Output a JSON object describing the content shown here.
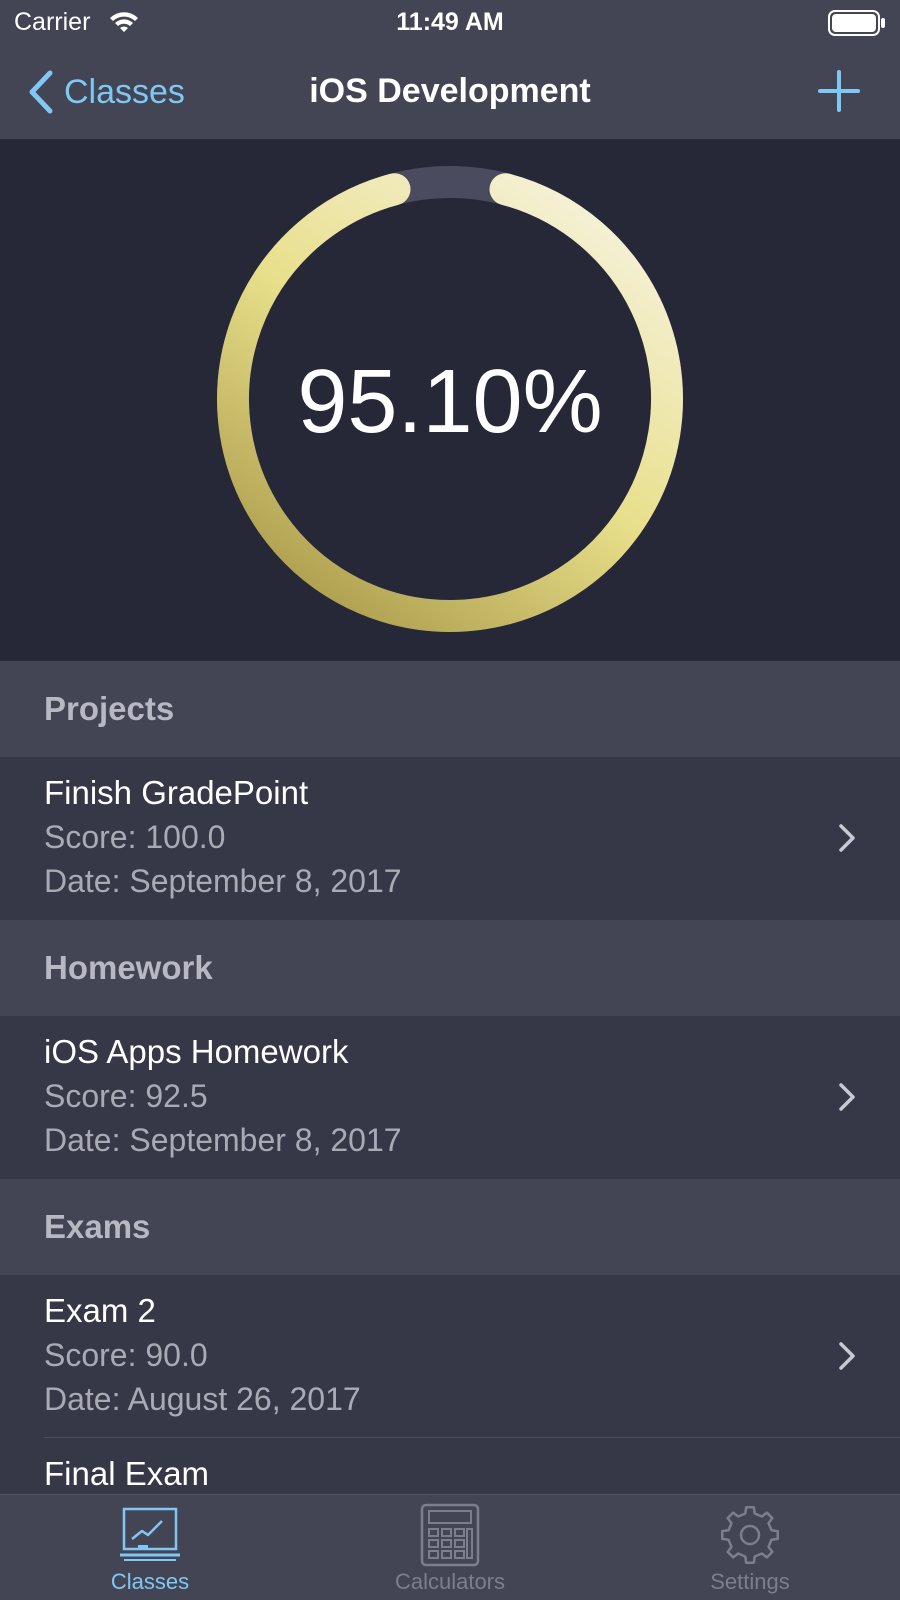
{
  "status_bar": {
    "carrier": "Carrier",
    "time": "11:49 AM",
    "icons": [
      "wifi-icon",
      "battery-icon"
    ]
  },
  "nav": {
    "back_label": "Classes",
    "title": "iOS Development",
    "add_icon": "plus-icon"
  },
  "grade": {
    "value": "95.10%",
    "percent": 95.1
  },
  "colors": {
    "accent": "#7fc8f3",
    "ring_gold_start": "#a99a4a",
    "ring_gold_mid": "#e8df8a",
    "ring_gold_end": "#f6f2dc",
    "ring_track": "#4a4b5e"
  },
  "sections": [
    {
      "header": "Projects",
      "items": [
        {
          "title": "Finish GradePoint",
          "score": "Score: 100.0",
          "date": "Date: September 8, 2017"
        }
      ]
    },
    {
      "header": "Homework",
      "items": [
        {
          "title": "iOS Apps Homework",
          "score": "Score: 92.5",
          "date": "Date: September 8, 2017"
        }
      ]
    },
    {
      "header": "Exams",
      "items": [
        {
          "title": "Exam 2",
          "score": "Score: 90.0",
          "date": "Date: August 26, 2017"
        },
        {
          "title": "Final Exam",
          "score": "",
          "date": ""
        }
      ]
    }
  ],
  "tabs": [
    {
      "label": "Classes",
      "icon": "chart-board-icon",
      "selected": true
    },
    {
      "label": "Calculators",
      "icon": "calculator-icon",
      "selected": false
    },
    {
      "label": "Settings",
      "icon": "gear-icon",
      "selected": false
    }
  ]
}
